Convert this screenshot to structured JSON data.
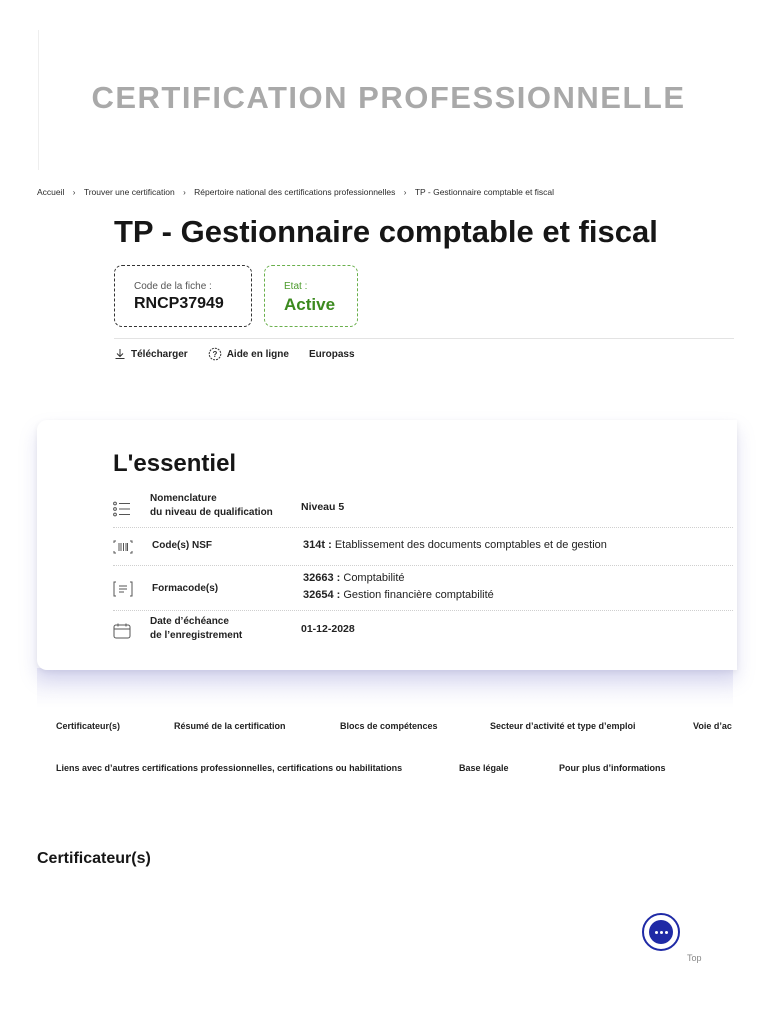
{
  "hero": {
    "title": "CERTIFICATION PROFESSIONNELLE"
  },
  "breadcrumb": [
    {
      "label": "Accueil"
    },
    {
      "label": "Trouver une certification"
    },
    {
      "label": "Répertoire national des certifications professionnelles"
    },
    {
      "label": "TP - Gestionnaire comptable et fiscal"
    }
  ],
  "page": {
    "title": "TP - Gestionnaire comptable et fiscal",
    "code_label": "Code de la fiche :",
    "code_value": "RNCP37949",
    "etat_label": "Etat :",
    "etat_value": "Active"
  },
  "actions": {
    "download": "Télécharger",
    "help": "Aide en ligne",
    "europass": "Europass"
  },
  "essentiel": {
    "title": "L'essentiel",
    "rows": [
      {
        "label_line1": "Nomenclature",
        "label_line2": "du niveau de qualification",
        "value": "Niveau 5"
      },
      {
        "label": "Code(s) NSF",
        "code": "314t :",
        "text": "Etablissement des documents comptables et de gestion"
      },
      {
        "label": "Formacode(s)",
        "code1": "32663 :",
        "text1": "Comptabilité",
        "code2": "32654 :",
        "text2": "Gestion financière comptabilité"
      },
      {
        "label_line1": "Date d’échéance",
        "label_line2": "de l’enregistrement",
        "value": "01-12-2028"
      }
    ]
  },
  "tabs_row1": [
    "Certificateur(s)",
    "Résumé de la certification",
    "Blocs de compétences",
    "Secteur d’activité et type d’emploi",
    "Voie d’ac"
  ],
  "tabs_row2": [
    "Liens avec d’autres certifications professionnelles, certifications ou habilitations",
    "Base légale",
    "Pour plus d’informations"
  ],
  "section": {
    "title": "Certificateur(s)"
  },
  "footer": {
    "top_label": "Top"
  },
  "colors": {
    "accent_blue": "#1f2aa6",
    "active_green": "#3c8a1f",
    "hero_grey": "#a9a9a9"
  }
}
